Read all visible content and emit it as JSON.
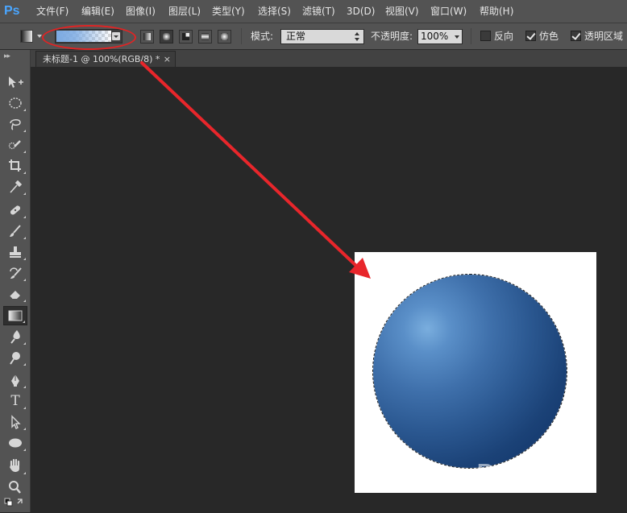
{
  "app": {
    "logo": "Ps"
  },
  "menu": [
    {
      "label": "文件(F)"
    },
    {
      "label": "编辑(E)"
    },
    {
      "label": "图像(I)"
    },
    {
      "label": "图层(L)"
    },
    {
      "label": "类型(Y)"
    },
    {
      "label": "选择(S)"
    },
    {
      "label": "滤镜(T)"
    },
    {
      "label": "3D(D)"
    },
    {
      "label": "视图(V)"
    },
    {
      "label": "窗口(W)"
    },
    {
      "label": "帮助(H)"
    }
  ],
  "options": {
    "mode_label": "模式:",
    "mode_value": "正常",
    "opacity_label": "不透明度:",
    "opacity_value": "100%",
    "reverse_label": "反向",
    "reverse_checked": false,
    "dither_label": "仿色",
    "dither_checked": true,
    "transparency_label": "透明区域",
    "transparency_checked": true,
    "gradient_types": [
      "linear",
      "radial",
      "angle",
      "reflected",
      "diamond"
    ],
    "active_gradient_type": "radial",
    "highlight_color": "#e02424"
  },
  "document": {
    "tab_title": "未标题-1 @ 100%(RGB/8) *",
    "close_glyph": "×"
  },
  "tools": [
    {
      "name": "move-tool",
      "icon": "move-icon"
    },
    {
      "name": "elliptical-marquee-tool",
      "icon": "ellipse-marquee-icon"
    },
    {
      "name": "lasso-tool",
      "icon": "lasso-icon"
    },
    {
      "name": "quick-selection-tool",
      "icon": "quick-select-icon"
    },
    {
      "name": "crop-tool",
      "icon": "crop-icon"
    },
    {
      "name": "eyedropper-tool",
      "icon": "eyedropper-icon"
    },
    {
      "name": "healing-brush-tool",
      "icon": "bandage-icon"
    },
    {
      "name": "brush-tool",
      "icon": "brush-icon"
    },
    {
      "name": "clone-stamp-tool",
      "icon": "stamp-icon"
    },
    {
      "name": "history-brush-tool",
      "icon": "history-brush-icon"
    },
    {
      "name": "eraser-tool",
      "icon": "eraser-icon"
    },
    {
      "name": "gradient-tool",
      "icon": "gradient-icon",
      "active": true
    },
    {
      "name": "blur-tool",
      "icon": "blur-icon"
    },
    {
      "name": "dodge-tool",
      "icon": "dodge-icon"
    },
    {
      "name": "pen-tool",
      "icon": "pen-icon"
    },
    {
      "name": "type-tool",
      "icon": "type-icon"
    },
    {
      "name": "path-selection-tool",
      "icon": "arrow-icon"
    },
    {
      "name": "ellipse-shape-tool",
      "icon": "ellipse-shape-icon"
    },
    {
      "name": "hand-tool",
      "icon": "hand-icon"
    },
    {
      "name": "zoom-tool",
      "icon": "zoom-icon"
    }
  ],
  "canvas": {
    "background_color": "#ffffff",
    "sphere_highlight": "#7aaede",
    "sphere_shadow": "#0d2f63"
  },
  "annotation": {
    "arrow_color": "#e8262b"
  },
  "watermark": {
    "line1": "Baidu经验",
    "line2": "jingyan.baidu.com"
  }
}
